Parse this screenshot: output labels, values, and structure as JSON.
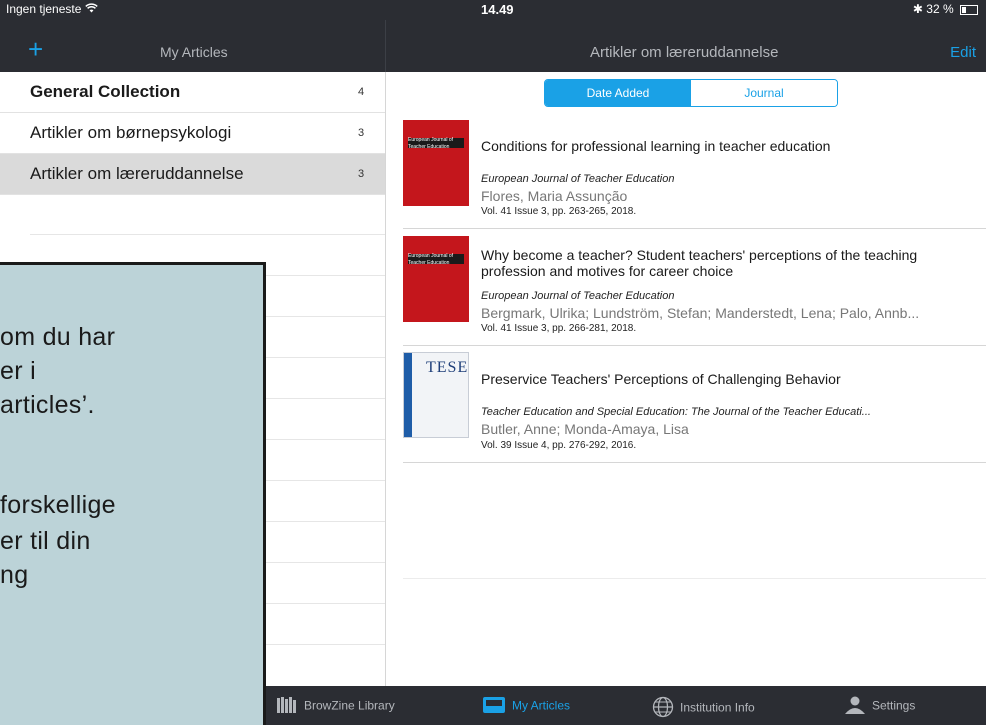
{
  "status_bar": {
    "carrier": "Ingen tjeneste",
    "time": "14.49",
    "battery": "32 %"
  },
  "nav": {
    "left_title": "My Articles",
    "right_title": "Artikler om læreruddannelse",
    "edit": "Edit",
    "add": "+"
  },
  "collections": [
    {
      "label": "General Collection",
      "count": "4"
    },
    {
      "label": "Artikler om børnepsykologi",
      "count": "3"
    },
    {
      "label": "Artikler om læreruddannelse",
      "count": "3"
    }
  ],
  "segments": {
    "date_added": "Date Added",
    "journal": "Journal"
  },
  "articles": [
    {
      "title": "Conditions for professional learning in teacher education",
      "journal": "European Journal of Teacher Education",
      "authors": "Flores, Maria Assunção",
      "volume": "Vol. 41 Issue 3, pp. 263-265, 2018.",
      "cover_text_1": "European Journal of",
      "cover_text_2": "Teacher Education"
    },
    {
      "title": "Why become a teacher? Student teachers' perceptions of the teaching profession and motives for career choice",
      "journal": "European Journal of Teacher Education",
      "authors": "Bergmark, Ulrika; Lundström, Stefan; Manderstedt, Lena; Palo, Annb...",
      "volume": "Vol. 41 Issue 3, pp. 266-281, 2018.",
      "cover_text_1": "European Journal of",
      "cover_text_2": "Teacher Education"
    },
    {
      "title": "Preservice Teachers' Perceptions of Challenging Behavior",
      "journal": "Teacher Education and Special Education: The Journal of the Teacher Educati...",
      "authors": "Butler, Anne; Monda-Amaya, Lisa",
      "volume": "Vol. 39 Issue 4, pp. 276-292, 2016.",
      "cover_text_1": "TESE"
    }
  ],
  "tabbar": {
    "library": "BrowZine Library",
    "my_articles": "My Articles",
    "institution": "Institution Info",
    "settings": "Settings"
  },
  "callout": {
    "lines": [
      "om du har",
      "er i",
      " articles’.",
      "",
      "forskellige",
      "er til din",
      "ng"
    ]
  },
  "colors": {
    "accent": "#1aa1e6",
    "bar": "#2b2d33",
    "callout_bg": "#bcd3d8"
  }
}
